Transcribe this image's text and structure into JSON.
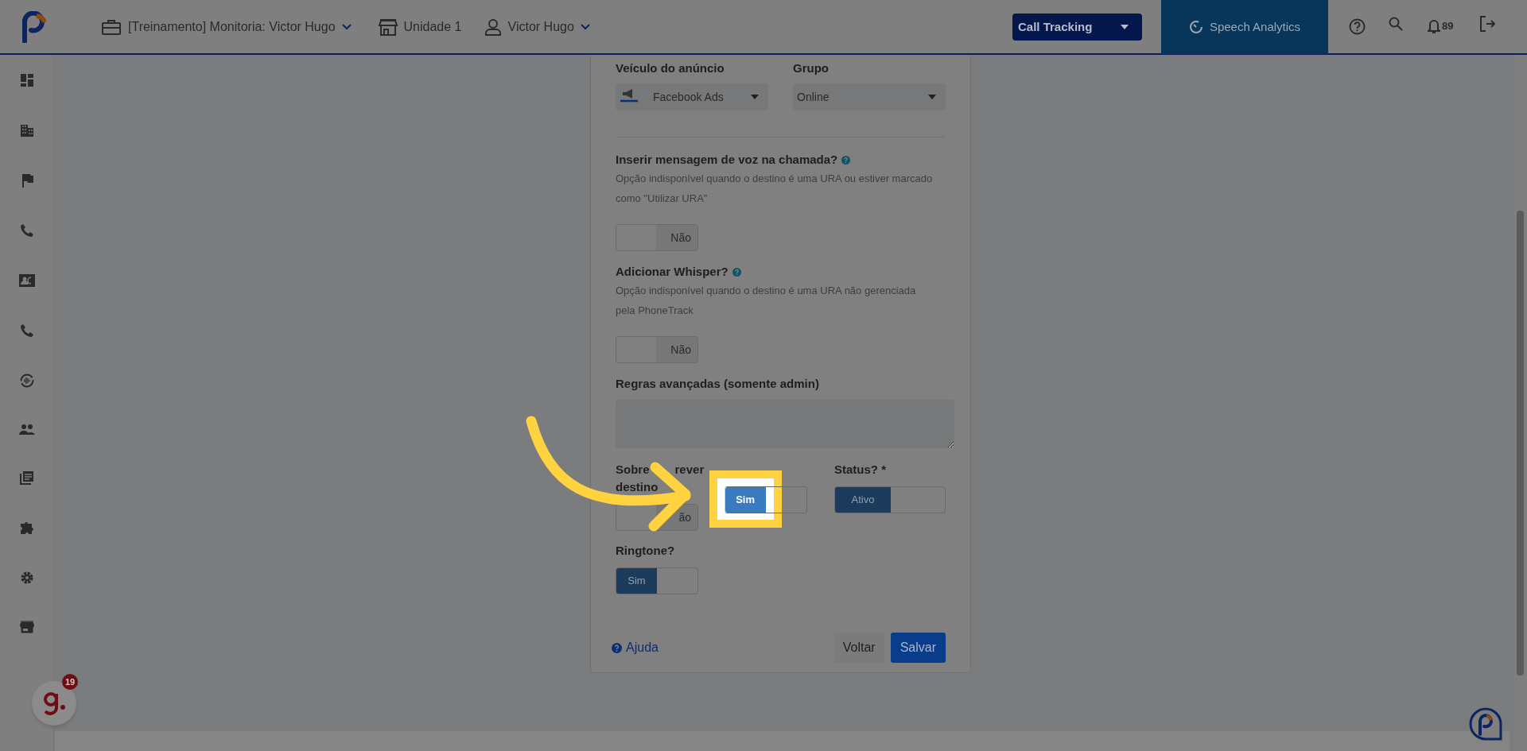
{
  "header": {
    "context": "[Treinamento] Monitoria: Victor Hugo",
    "unit": "Unidade 1",
    "user": "Victor Hugo",
    "product_select": "Call Tracking",
    "speech_tab": "Speech Analytics",
    "notifications": "89"
  },
  "form": {
    "selects": [
      {
        "kind": "icon_select",
        "label": "Veículo do anúncio",
        "value": "Facebook Ads"
      },
      {
        "kind": "select",
        "label": "Grupo",
        "value": "Online"
      }
    ],
    "fields": [
      {
        "kind": "toggle",
        "label": "Inserir mensagem de voz na chamada?",
        "help": true,
        "help_text": "Opção indisponível quando o destino é uma URA ou estiver marcado como \"Utilizar URA\"",
        "toggle": {
          "label": "Não",
          "on": false,
          "highlighted": false
        }
      },
      {
        "kind": "toggle",
        "label": "Adicionar Whisper?",
        "help": true,
        "help_text": "Opção indisponível quando o destino é uma URA não gerenciada pela PhoneTrack",
        "toggle": {
          "label": "Não",
          "on": false,
          "highlighted": false
        }
      },
      {
        "kind": "textarea",
        "label": "Regras avançadas (somente admin)"
      }
    ],
    "toggle_row": [
      {
        "label_parts": [
          "Sobre",
          "rever",
          "destino"
        ],
        "toggle": {
          "label": "ão",
          "on": false,
          "highlighted": false
        }
      },
      {
        "toggle": {
          "label": "Sim",
          "on": true,
          "highlighted": true
        }
      },
      {
        "label": "Status? *",
        "toggle": {
          "label": "Ativo",
          "on": true,
          "highlighted": false
        }
      }
    ],
    "ringtone": {
      "label": "Ringtone?",
      "toggle": {
        "label": "Sim",
        "on": true,
        "highlighted": false
      }
    },
    "help_link": "Ajuda",
    "buttons": [
      "Voltar",
      "Salvar"
    ]
  },
  "chat_badge": "19"
}
